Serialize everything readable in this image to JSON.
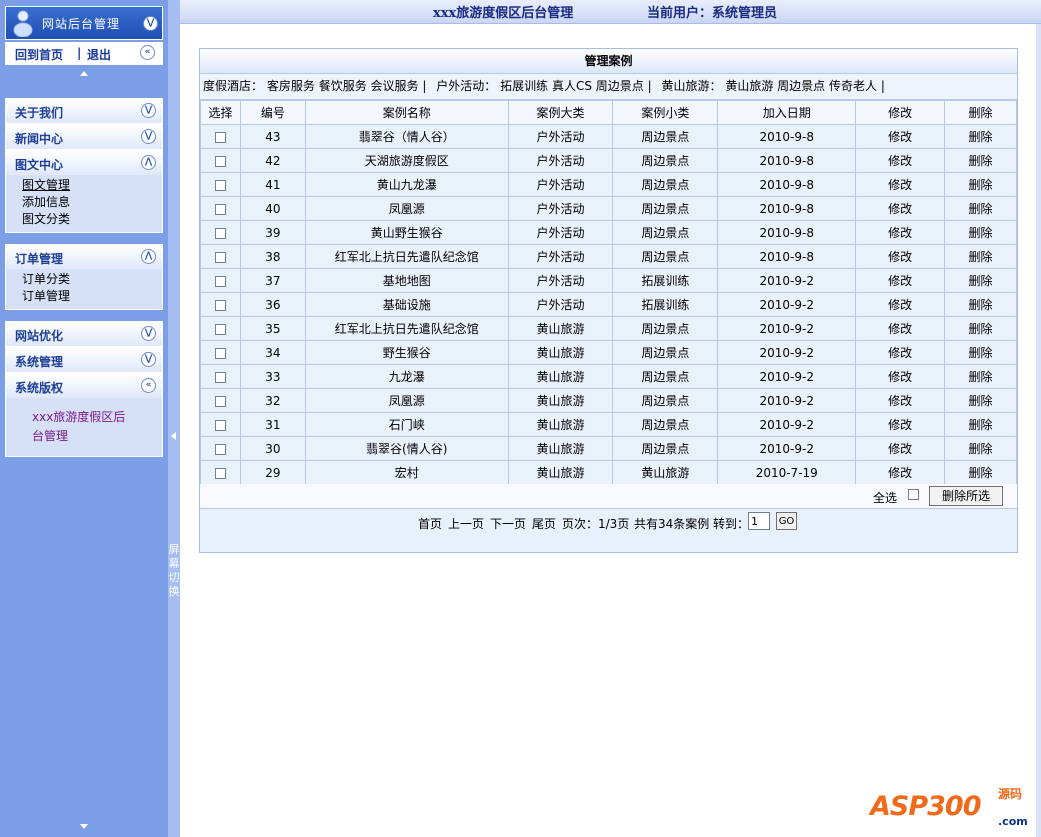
{
  "sidebar": {
    "logo_text": "网站后台管理",
    "home_link": "回到首页",
    "separator": "|",
    "logout_link": "退出",
    "menus": {
      "about": {
        "title": "关于我们"
      },
      "news": {
        "title": "新闻中心"
      },
      "gallery": {
        "title": "图文中心",
        "items": [
          "图文管理",
          "添加信息",
          "图文分类"
        ]
      },
      "orders": {
        "title": "订单管理",
        "items": [
          "订单分类",
          "订单管理"
        ]
      },
      "seo": {
        "title": "网站优化"
      },
      "system": {
        "title": "系统管理"
      },
      "copyright": {
        "title": "系统版权",
        "line1": "xxx旅游度假区后",
        "line2": "台管理"
      }
    },
    "splitter_text": "屏幕切换"
  },
  "header": {
    "title": "xxx旅游度假区后台管理",
    "current_user": "当前用户：系统管理员"
  },
  "panel": {
    "title": "管理案例",
    "categories": {
      "hotel_label": "度假酒店：",
      "hotel_items": [
        "客房服务",
        "餐饮服务",
        "会议服务"
      ],
      "outdoor_label": "户外活动：",
      "outdoor_items": [
        "拓展训练",
        "真人CS",
        "周边景点"
      ],
      "huangshan_label": "黄山旅游：",
      "huangshan_items": [
        "黄山旅游",
        "周边景点",
        "传奇老人"
      ],
      "sep": "|"
    },
    "columns": [
      "选择",
      "编号",
      "案例名称",
      "案例大类",
      "案例小类",
      "加入日期",
      "修改",
      "删除"
    ],
    "rows": [
      {
        "id": "43",
        "name": "翡翠谷（情人谷）",
        "category": "户外活动",
        "subcategory": "周边景点",
        "date": "2010-9-8",
        "edit": "修改",
        "delete": "删除"
      },
      {
        "id": "42",
        "name": "天湖旅游度假区",
        "category": "户外活动",
        "subcategory": "周边景点",
        "date": "2010-9-8",
        "edit": "修改",
        "delete": "删除"
      },
      {
        "id": "41",
        "name": "黄山九龙瀑",
        "category": "户外活动",
        "subcategory": "周边景点",
        "date": "2010-9-8",
        "edit": "修改",
        "delete": "删除"
      },
      {
        "id": "40",
        "name": "凤凰源",
        "category": "户外活动",
        "subcategory": "周边景点",
        "date": "2010-9-8",
        "edit": "修改",
        "delete": "删除"
      },
      {
        "id": "39",
        "name": "黄山野生猴谷",
        "category": "户外活动",
        "subcategory": "周边景点",
        "date": "2010-9-8",
        "edit": "修改",
        "delete": "删除"
      },
      {
        "id": "38",
        "name": "红军北上抗日先遣队纪念馆",
        "category": "户外活动",
        "subcategory": "周边景点",
        "date": "2010-9-8",
        "edit": "修改",
        "delete": "删除"
      },
      {
        "id": "37",
        "name": "基地地图",
        "category": "户外活动",
        "subcategory": "拓展训练",
        "date": "2010-9-2",
        "edit": "修改",
        "delete": "删除"
      },
      {
        "id": "36",
        "name": "基础设施",
        "category": "户外活动",
        "subcategory": "拓展训练",
        "date": "2010-9-2",
        "edit": "修改",
        "delete": "删除"
      },
      {
        "id": "35",
        "name": "红军北上抗日先遣队纪念馆",
        "category": "黄山旅游",
        "subcategory": "周边景点",
        "date": "2010-9-2",
        "edit": "修改",
        "delete": "删除"
      },
      {
        "id": "34",
        "name": "野生猴谷",
        "category": "黄山旅游",
        "subcategory": "周边景点",
        "date": "2010-9-2",
        "edit": "修改",
        "delete": "删除"
      },
      {
        "id": "33",
        "name": "九龙瀑",
        "category": "黄山旅游",
        "subcategory": "周边景点",
        "date": "2010-9-2",
        "edit": "修改",
        "delete": "删除"
      },
      {
        "id": "32",
        "name": "凤凰源",
        "category": "黄山旅游",
        "subcategory": "周边景点",
        "date": "2010-9-2",
        "edit": "修改",
        "delete": "删除"
      },
      {
        "id": "31",
        "name": "石门峡",
        "category": "黄山旅游",
        "subcategory": "周边景点",
        "date": "2010-9-2",
        "edit": "修改",
        "delete": "删除"
      },
      {
        "id": "30",
        "name": "翡翠谷(情人谷)",
        "category": "黄山旅游",
        "subcategory": "周边景点",
        "date": "2010-9-2",
        "edit": "修改",
        "delete": "删除"
      },
      {
        "id": "29",
        "name": "宏村",
        "category": "黄山旅游",
        "subcategory": "黄山旅游",
        "date": "2010-7-19",
        "edit": "修改",
        "delete": "删除"
      }
    ],
    "select_all_label": "全选",
    "delete_selected_label": "删除所选",
    "pager": {
      "first": "首页",
      "prev": "上一页",
      "next": "下一页",
      "last": "尾页",
      "page_info": "页次：1/3页",
      "total": "共有34条案例",
      "goto_label": "转到：",
      "goto_value": "1",
      "go": "GO"
    }
  },
  "watermark": {
    "main": "ASP300",
    "sub": "源码",
    "domain": ".com"
  }
}
